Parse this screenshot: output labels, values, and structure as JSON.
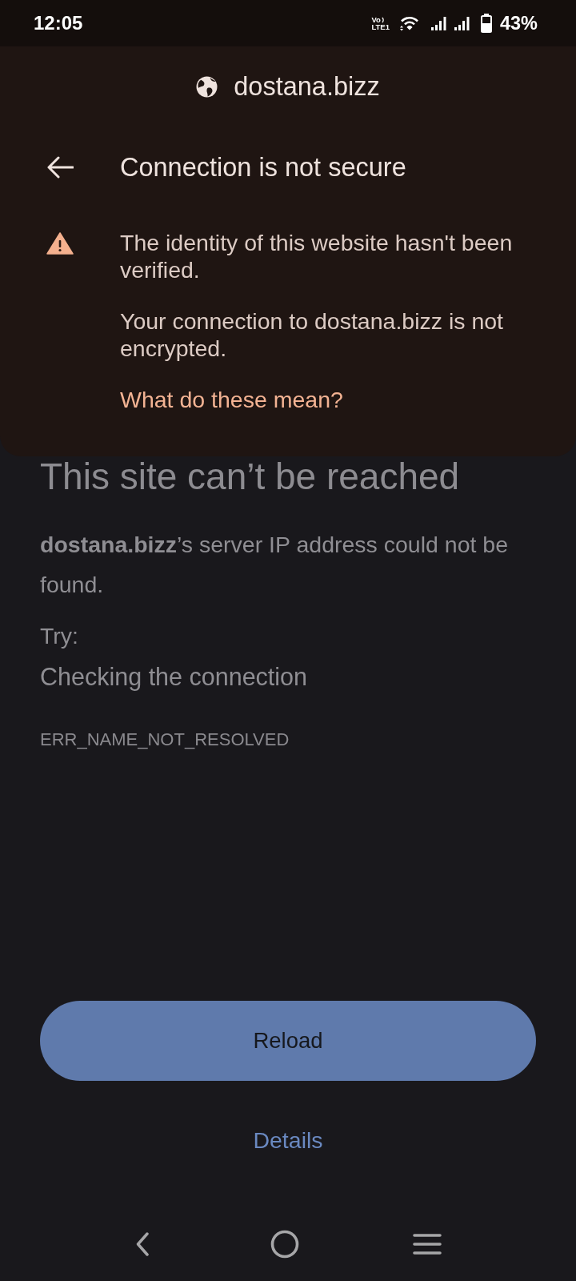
{
  "status_bar": {
    "time": "12:05",
    "network_badge": {
      "top": "Vo",
      "bottom": "LTE1"
    },
    "battery_percent": "43%"
  },
  "site_info_popup": {
    "domain": "dostana.bizz",
    "title": "Connection is not secure",
    "messages": [
      "The identity of this website hasn't been verified.",
      "Your connection to dostana.bizz is not encrypted."
    ],
    "link": "What do these mean?"
  },
  "error_page": {
    "heading": "This site can’t be reached",
    "message": "**dostana.bizz**’s server IP address could not be found.",
    "try_label": "Try:",
    "suggestions": [
      "Checking the connection"
    ],
    "error_code": "ERR_NAME_NOT_RESOLVED",
    "reload_button": "Reload",
    "details_button": "Details"
  }
}
